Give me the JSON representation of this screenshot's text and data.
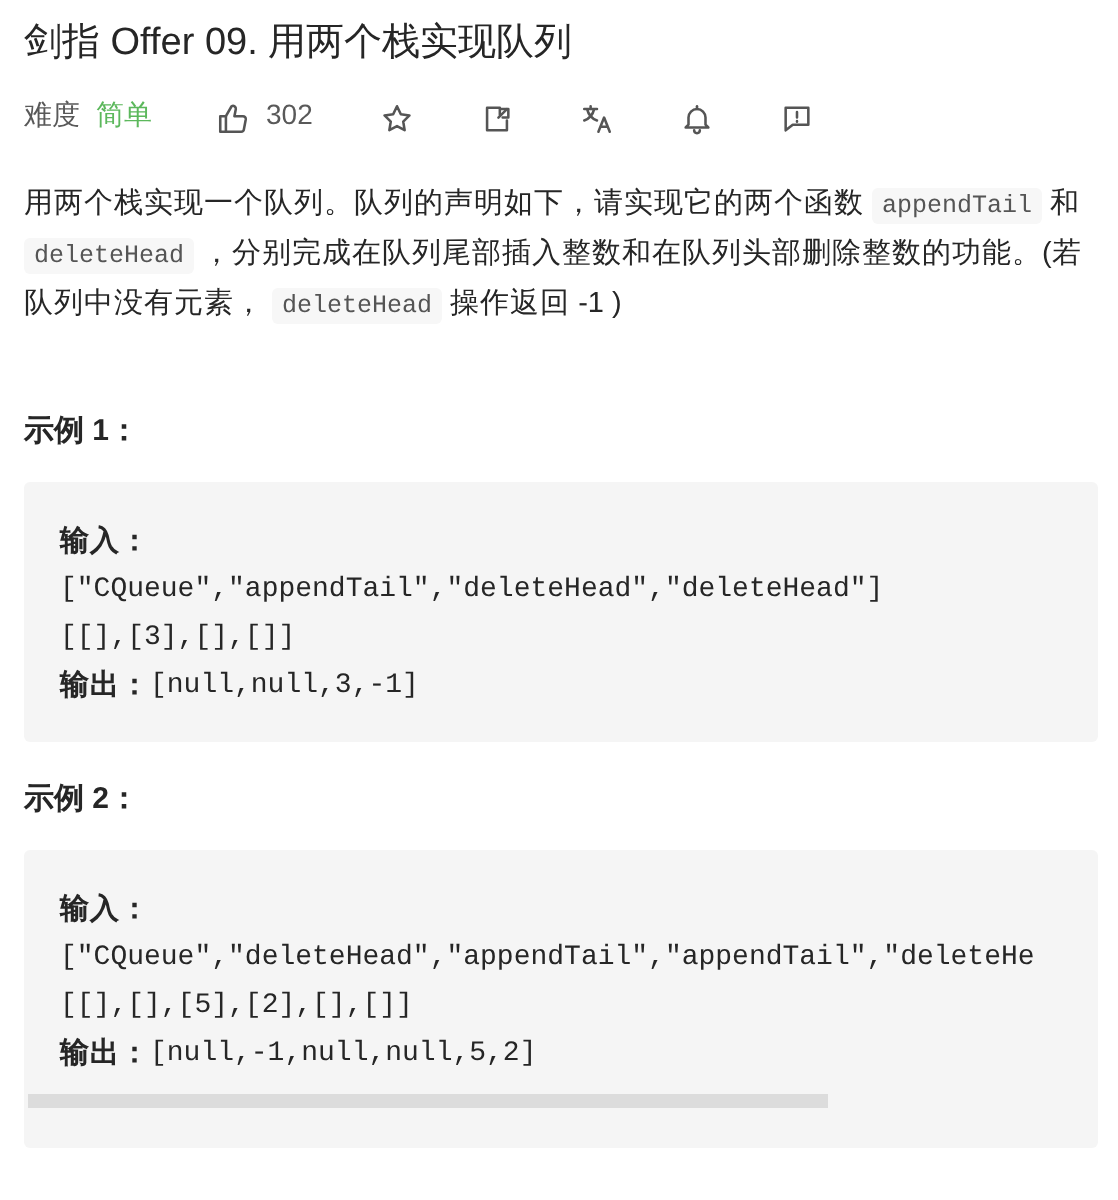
{
  "title": "剑指 Offer 09. 用两个栈实现队列",
  "meta": {
    "difficulty_label": "难度",
    "difficulty": "简单",
    "likes": "302"
  },
  "description": [
    {
      "kind": "text",
      "text": "用两个栈实现一个队列。队列的声明如下，请实现它的两个函数 "
    },
    {
      "kind": "code",
      "text": "appendTail"
    },
    {
      "kind": "text",
      "text": " 和 "
    },
    {
      "kind": "code",
      "text": "deleteHead"
    },
    {
      "kind": "text",
      "text": " ，分别完成在队列尾部插入整数和在队列头部删除整数的功能。(若队列中没有元素， "
    },
    {
      "kind": "code",
      "text": "deleteHead"
    },
    {
      "kind": "text",
      "text": " 操作返回 -1 )"
    }
  ],
  "examples": [
    {
      "title": "示例 1：",
      "input_label": "输入：",
      "input_lines": [
        "[\"CQueue\",\"appendTail\",\"deleteHead\",\"deleteHead\"]",
        "[[],[3],[],[]]"
      ],
      "output_label": "输出：",
      "output_value": "[null,null,3,-1]"
    },
    {
      "title": "示例 2：",
      "input_label": "输入：",
      "input_lines": [
        "[\"CQueue\",\"deleteHead\",\"appendTail\",\"appendTail\",\"deleteHe",
        "[[],[],[5],[2],[],[]]"
      ],
      "output_label": "输出：",
      "output_value": "[null,-1,null,null,5,2]"
    }
  ]
}
